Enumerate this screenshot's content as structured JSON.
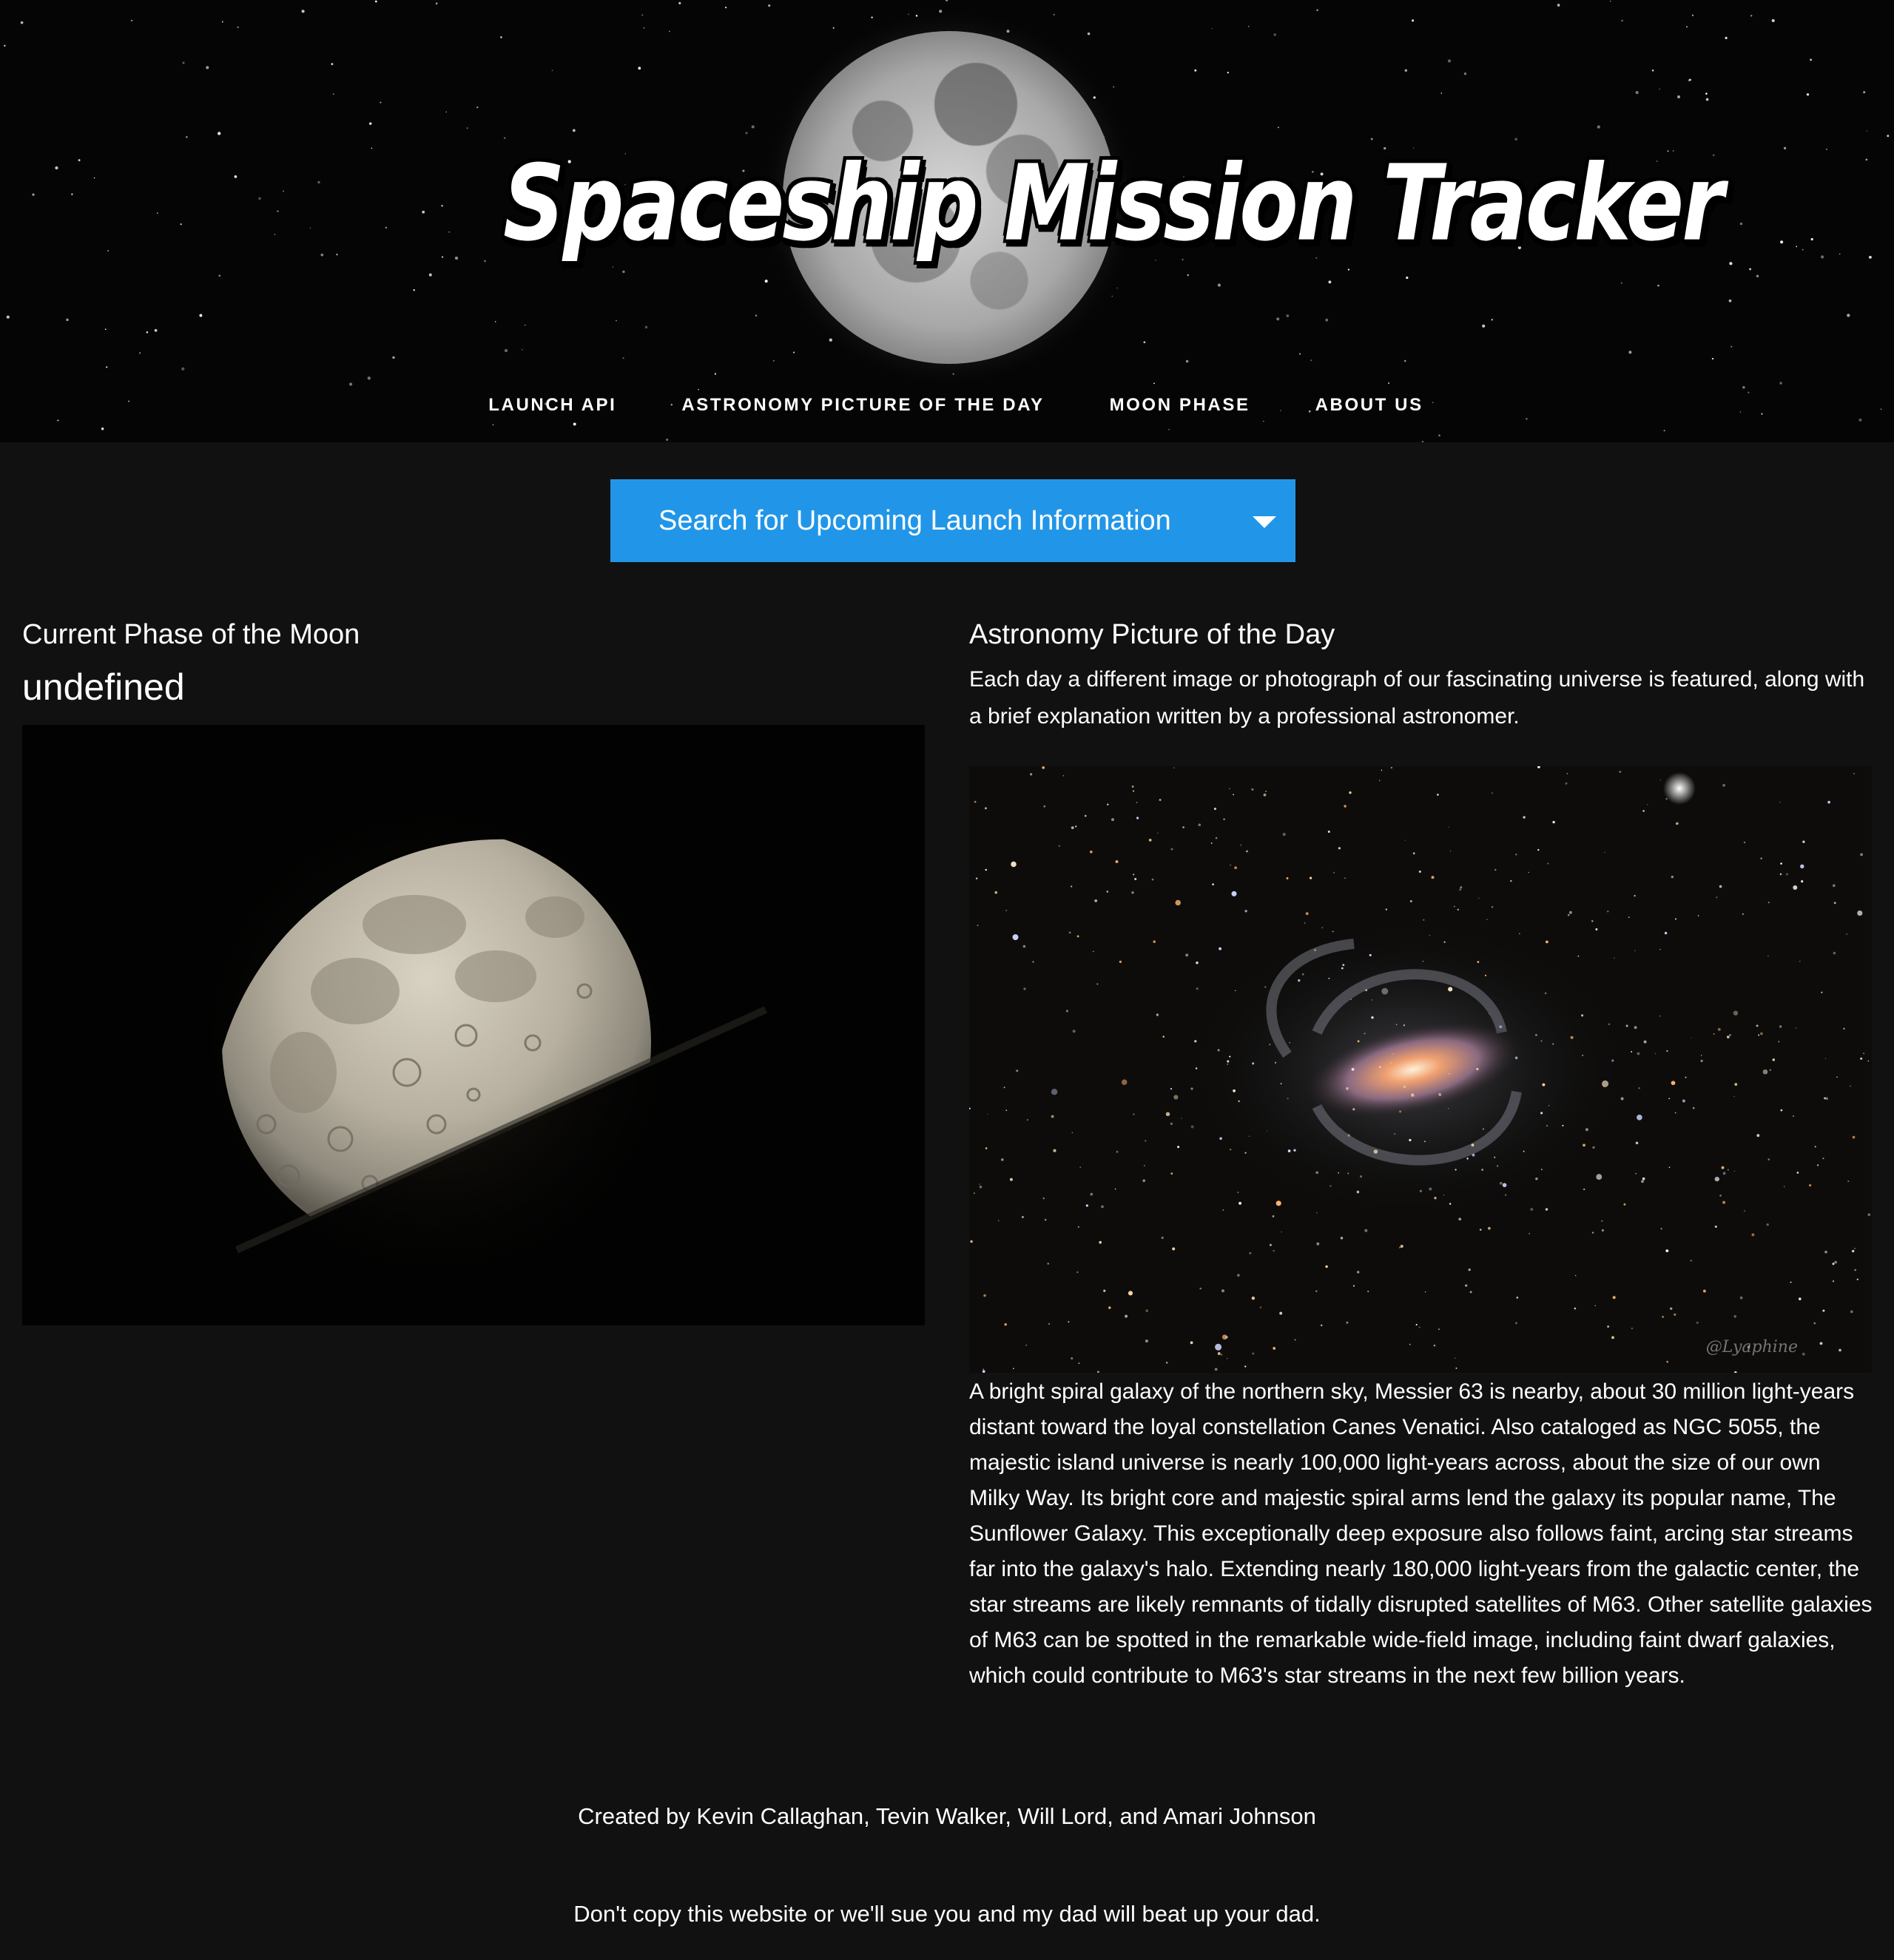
{
  "header": {
    "title": "Spaceship Mission Tracker",
    "nav": [
      "LAUNCH API",
      "ASTRONOMY PICTURE OF THE DAY",
      "MOON PHASE",
      "ABOUT US"
    ]
  },
  "search": {
    "label": "Search for Upcoming Launch Information"
  },
  "moon": {
    "heading": "Current Phase of the Moon",
    "phase_name": "undefined"
  },
  "apod": {
    "heading": "Astronomy Picture of the Day",
    "intro": "Each day a different image or photograph of our fascinating universe is featured, along with a brief explanation written by a professional astronomer.",
    "image_credit": "@Lyaphine",
    "explanation": "A bright spiral galaxy of the northern sky, Messier 63 is nearby, about 30 million light-years distant toward the loyal constellation Canes Venatici. Also cataloged as NGC 5055, the majestic island universe is nearly 100,000 light-years across, about the size of our own Milky Way. Its bright core and majestic spiral arms lend the galaxy its popular name, The Sunflower Galaxy. This exceptionally deep exposure also follows faint, arcing star streams far into the galaxy's halo. Extending nearly 180,000 light-years from the galactic center, the star streams are likely remnants of tidally disrupted satellites of M63. Other satellite galaxies of M63 can be spotted in the remarkable wide-field image, including faint dwarf galaxies, which could contribute to M63's star streams in the next few billion years."
  },
  "footer": {
    "credits": "Created by Kevin Callaghan, Tevin Walker, Will Lord, and Amari Johnson",
    "warning": "Don't copy this website or we'll sue you and my dad will beat up your dad."
  },
  "colors": {
    "page_background": "#111111",
    "accent_button": "#2196e8",
    "text": "#ffffff"
  }
}
